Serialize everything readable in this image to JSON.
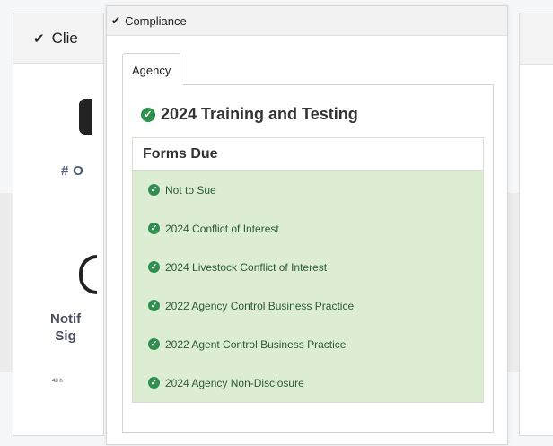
{
  "background": {
    "left_panel_title": "Clie",
    "left_label_1": "# O",
    "left_label_2_line1": "Notif",
    "left_label_2_line2": "Sig",
    "left_small_text": "48 h"
  },
  "modal": {
    "title": "Compliance",
    "tabs": [
      {
        "label": "Agency"
      }
    ],
    "section_title": "2024 Training and Testing",
    "forms_card": {
      "header": "Forms Due",
      "items": [
        {
          "label": "Not to Sue"
        },
        {
          "label": "2024 Conflict of Interest"
        },
        {
          "label": "2024 Livestock Conflict of Interest"
        },
        {
          "label": "2022 Agency Control Business Practice"
        },
        {
          "label": "2022 Agent Control Business Practice"
        },
        {
          "label": "2024 Agency Non-Disclosure"
        }
      ]
    }
  },
  "icons": {
    "check": "checkmark-icon",
    "check_circle": "check-circle-icon"
  },
  "colors": {
    "success_green": "#2f8f4e",
    "completed_bg": "#dcedd3",
    "completed_text": "#2b5a33"
  }
}
